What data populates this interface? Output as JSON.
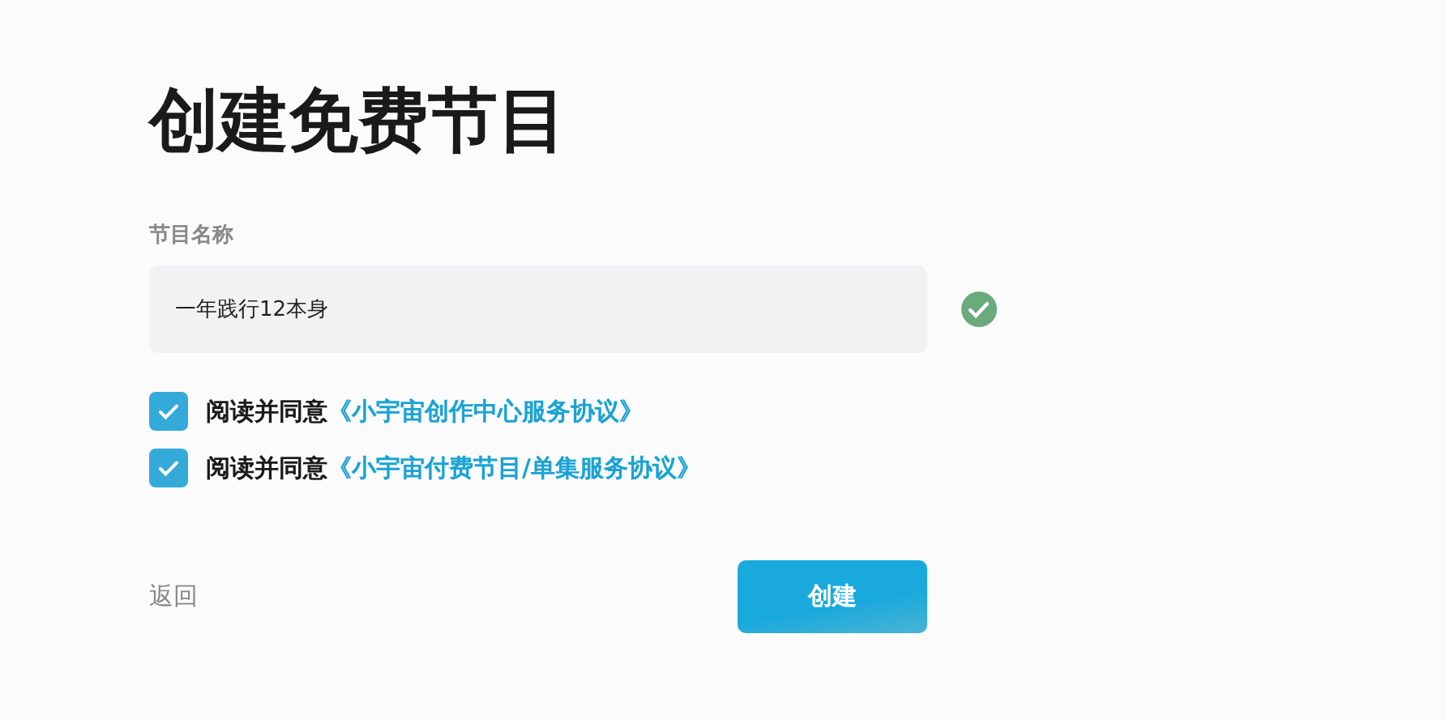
{
  "title": "创建免费节目",
  "name_field": {
    "label": "节目名称",
    "value": "一年践行12本身",
    "valid": true
  },
  "agreements": [
    {
      "checked": true,
      "prefix": "阅读并同意",
      "link": "《小宇宙创作中心服务协议》"
    },
    {
      "checked": true,
      "prefix": "阅读并同意",
      "link": "《小宇宙付费节目/单集服务协议》"
    }
  ],
  "back": "返回",
  "submit": "创建"
}
